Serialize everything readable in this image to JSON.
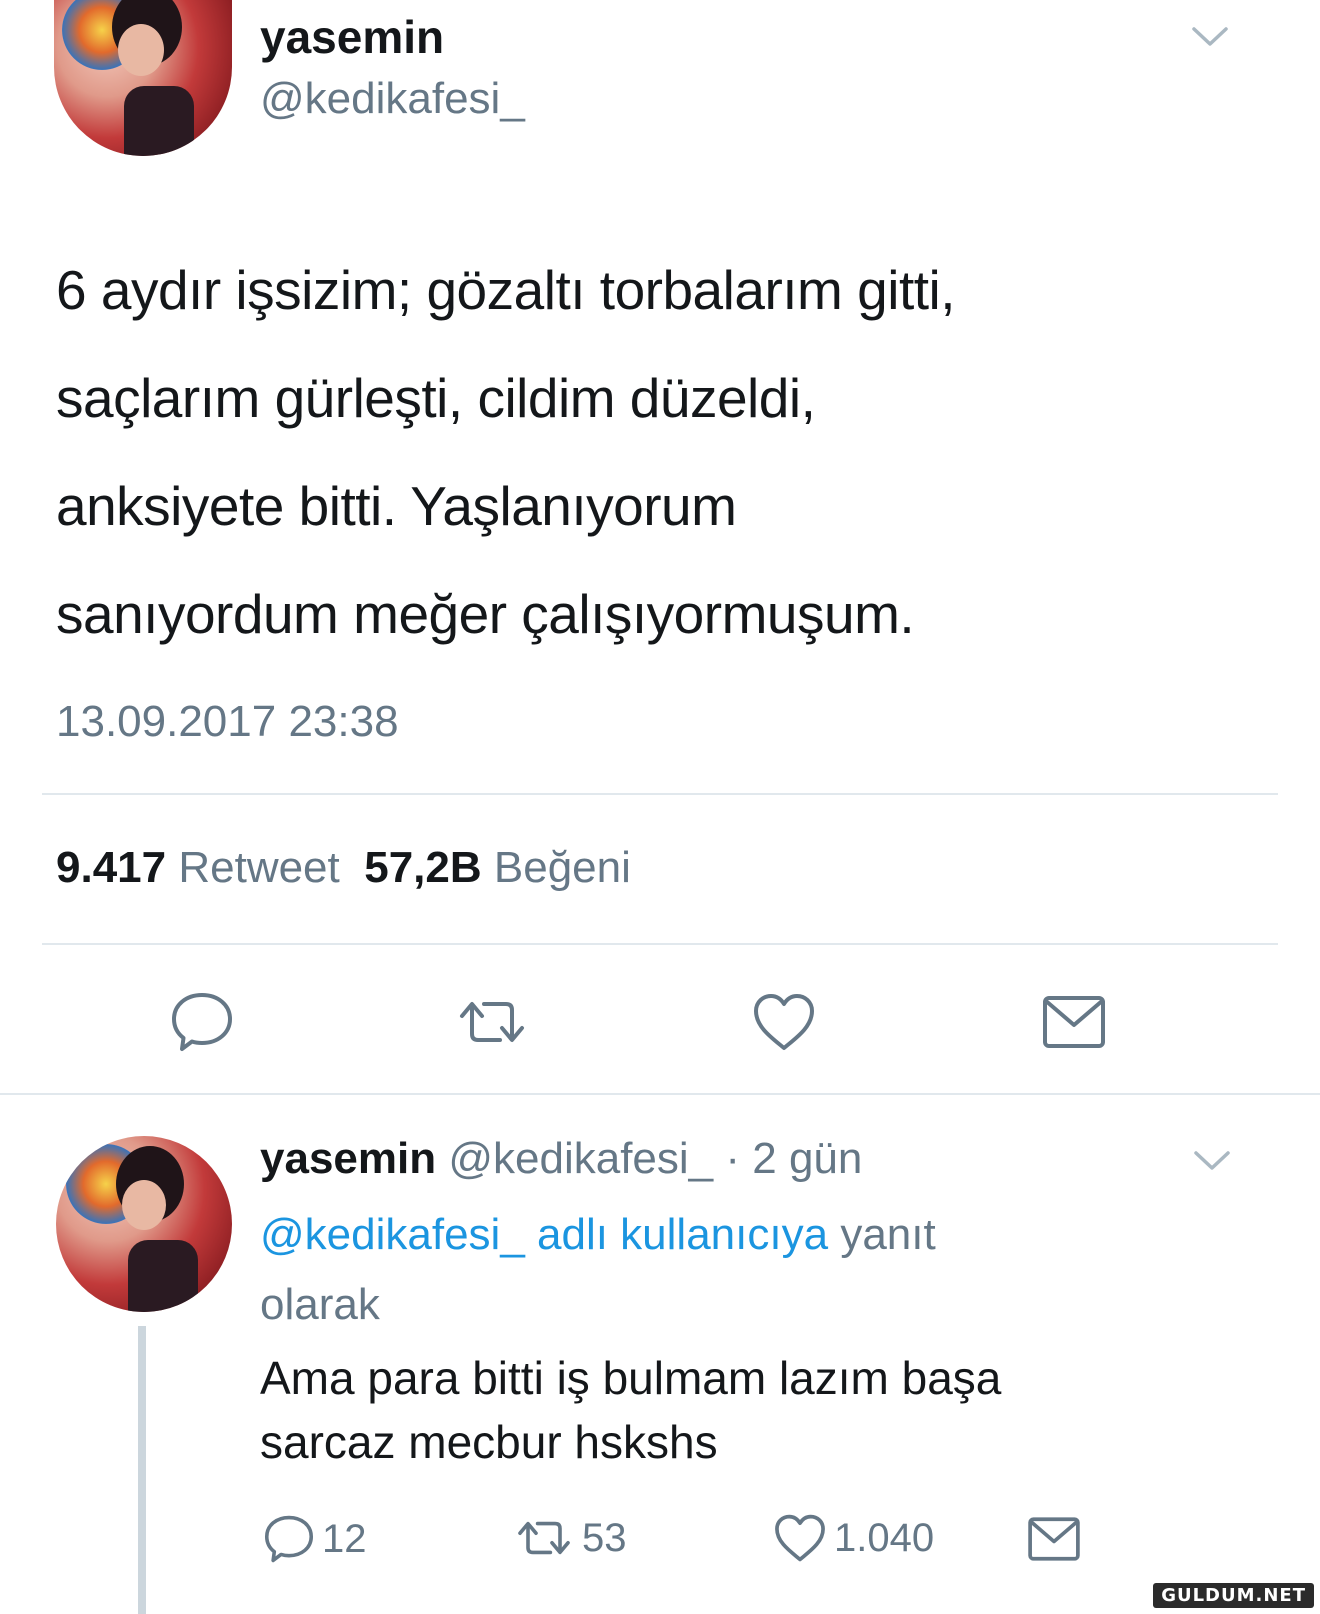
{
  "tweet": {
    "author_name": "yasemin",
    "author_handle": "@kedikafesi_",
    "text_lines": [
      "6 aydır işsizim; gözaltı torbalarım gitti,",
      "saçlarım gürleşti, cildim düzeldi,",
      "anksiyete bitti. Yaşlanıyorum",
      "sanıyordum meğer çalışıyormuşum."
    ],
    "timestamp": "13.09.2017 23:38",
    "stats": {
      "retweet_count": "9.417",
      "retweet_label": "Retweet",
      "like_count": "57,2B",
      "like_label": "Beğeni"
    },
    "actions": [
      "reply-icon",
      "retweet-icon",
      "like-icon",
      "message-icon"
    ]
  },
  "reply": {
    "author_name": "yasemin",
    "author_handle": "@kedikafesi_",
    "separator": "·",
    "time": "2 gün",
    "context_mention": "@kedikafesi_ adlı kullanıcıya",
    "context_rest_1": "yanıt",
    "context_rest_2": "olarak",
    "text_lines": [
      "Ama para bitti iş bulmam lazım başa",
      "sarcaz mecbur hskshs"
    ],
    "reply_count": "12",
    "retweet_count": "53",
    "like_count": "1.040"
  },
  "watermark": "GULDUM.NET",
  "colors": {
    "text_primary": "#14171a",
    "text_secondary": "#657786",
    "link": "#1b95e0",
    "divider": "#e1e8ed"
  }
}
